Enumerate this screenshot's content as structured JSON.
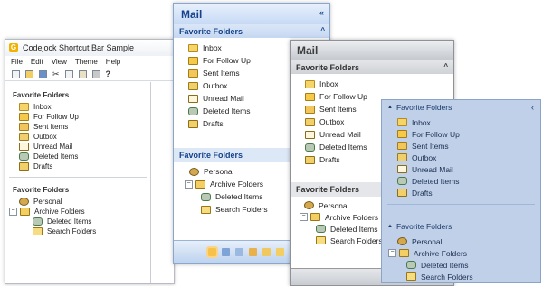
{
  "app": {
    "title": "Codejock Shortcut Bar Sample"
  },
  "menu": [
    "File",
    "Edit",
    "View",
    "Theme",
    "Help"
  ],
  "favorites_label": "Favorite Folders",
  "mail_label": "Mail",
  "folders": [
    "Inbox",
    "For Follow Up",
    "Sent Items",
    "Outbox",
    "Unread Mail",
    "Deleted Items",
    "Drafts"
  ],
  "tree": {
    "personal": "Personal",
    "archive": "Archive Folders",
    "deleted": "Deleted Items",
    "search": "Search Folders"
  },
  "icons": {
    "collapse": "«",
    "chevron_up": "^",
    "chevron_left": "‹",
    "expand_triangle": "▲",
    "tree_minus": "−"
  },
  "colors": {
    "blue_header": "#15428b",
    "pane_blue": "#bfd0e8",
    "selected_nav": "#f8c24a"
  }
}
